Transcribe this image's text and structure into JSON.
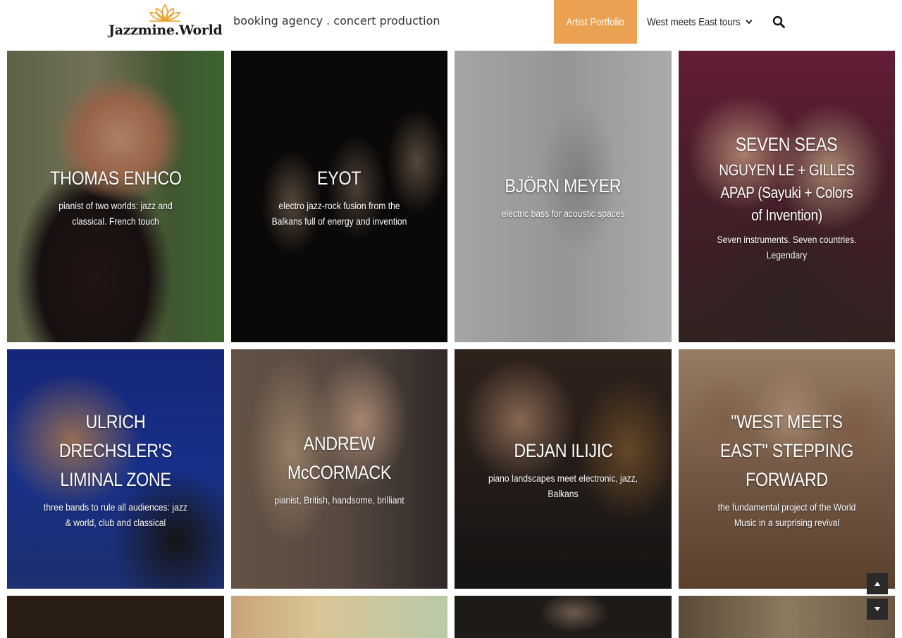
{
  "header": {
    "logo_text": "Jazzmine.World",
    "tagline": "booking agency . concert production",
    "nav": {
      "items": [
        {
          "label": "Artist Portfolio",
          "active": true
        },
        {
          "label": "West meets East tours",
          "has_dropdown": true
        }
      ],
      "search_icon": "search-icon"
    }
  },
  "colors": {
    "accent": "#eaa252",
    "logo_lotus": "#e9a12b",
    "text_dark": "#222222"
  },
  "artists": [
    {
      "title": "THOMAS ENHCO",
      "subtitle": "pianist of two worlds: jazz and classical. French touch"
    },
    {
      "title": "EYOT",
      "subtitle": "electro jazz-rock fusion from the Balkans full of energy and invention"
    },
    {
      "title": "BJÖRN MEYER",
      "subtitle": "electric bass for acoustic spaces"
    },
    {
      "title": "SEVEN SEAS",
      "title2": "NGUYEN LE + GILLES APAP (Sayuki + Colors of Invention)",
      "subtitle": "Seven instruments. Seven countries. Legendary"
    },
    {
      "title": "ULRICH DRECHSLER'S LIMINAL ZONE",
      "subtitle": "three bands to rule all audiences: jazz & world, club and classical"
    },
    {
      "title": "ANDREW McCORMACK",
      "subtitle": "pianist, British, handsome, brilliant"
    },
    {
      "title": "DEJAN ILIJIC",
      "subtitle": "piano landscapes meet electronic, jazz, Balkans"
    },
    {
      "title": "\"WEST MEETS EAST\" STEPPING FORWARD",
      "subtitle": "the fundamental project of the World Music in a surprising revival"
    }
  ],
  "scroll": {
    "up_icon": "arrow-up-icon",
    "down_icon": "arrow-down-icon"
  }
}
